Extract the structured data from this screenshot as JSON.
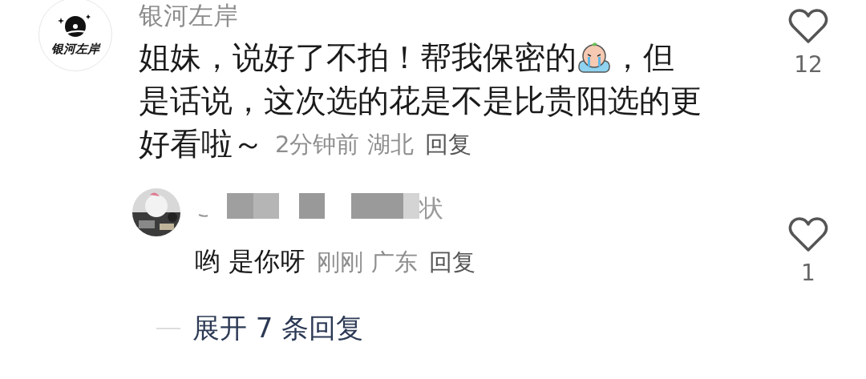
{
  "comment": {
    "avatar_logo_text": "银河左岸",
    "username": "银河左岸",
    "text_lines": [
      [
        {
          "kind": "text",
          "text": "姐妹，说好了不拍！帮我保密的"
        },
        {
          "kind": "emoji"
        },
        {
          "kind": "text",
          "text": "，但"
        }
      ],
      [
        {
          "kind": "text",
          "text": "是话说，这次选的花是不是比贵阳选的更"
        }
      ],
      [
        {
          "kind": "text",
          "text": "好看啦～"
        }
      ]
    ],
    "time": "2分钟前",
    "location": "湖北",
    "reply_label": "回复",
    "likes": "12",
    "liked": false,
    "replies": [
      {
        "username_redacted": true,
        "username_tail": "状",
        "text": "哟 是你呀",
        "time": "刚刚",
        "location": "广东",
        "reply_label": "回复",
        "likes": "1",
        "liked": false
      }
    ],
    "expand_label": "展开 7 条回复"
  }
}
